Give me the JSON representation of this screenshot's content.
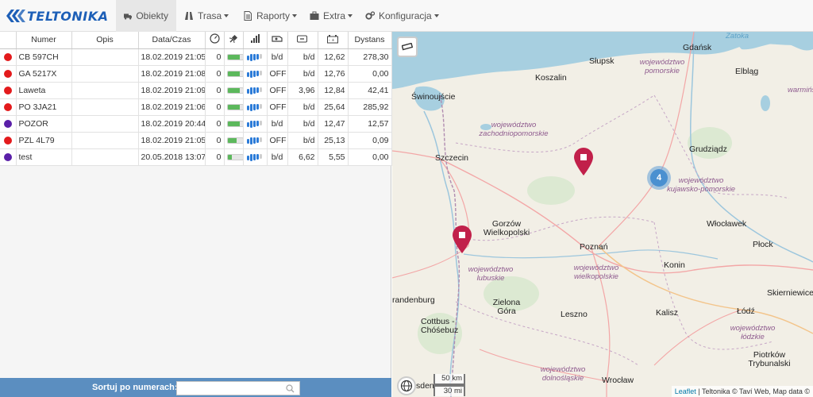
{
  "brand": {
    "name": "TELTONIKA",
    "color": "#1d5fb7"
  },
  "nav": {
    "items": [
      {
        "label": "Obiekty",
        "icon": "truck-icon",
        "active": true,
        "dropdown": false
      },
      {
        "label": "Trasa",
        "icon": "road-icon",
        "active": false,
        "dropdown": true
      },
      {
        "label": "Raporty",
        "icon": "document-icon",
        "active": false,
        "dropdown": true
      },
      {
        "label": "Extra",
        "icon": "briefcase-icon",
        "active": false,
        "dropdown": true
      },
      {
        "label": "Konfiguracja",
        "icon": "gears-icon",
        "active": false,
        "dropdown": true
      }
    ]
  },
  "table": {
    "columns": [
      "",
      "Numer",
      "Opis",
      "Data/Czas",
      "speedometer-icon",
      "satellite-icon",
      "signal-icon",
      "engine-icon",
      "battery-icon",
      "car-battery-icon",
      "Dystans"
    ],
    "rows": [
      {
        "status": "#e31a1c",
        "numer": "CB 597CH",
        "opis": "",
        "data": "18.02.2019 21:05",
        "speed": "0",
        "sat": 0.8,
        "gsm": 4,
        "engine": "b/d",
        "v1": "b/d",
        "v2": "12,62",
        "dystans": "278,30"
      },
      {
        "status": "#e31a1c",
        "numer": "GA 5217X",
        "opis": "",
        "data": "18.02.2019 21:08",
        "speed": "0",
        "sat": 0.8,
        "gsm": 4,
        "engine": "OFF",
        "v1": "b/d",
        "v2": "12,76",
        "dystans": "0,00"
      },
      {
        "status": "#e31a1c",
        "numer": "Laweta",
        "opis": "",
        "data": "18.02.2019 21:09",
        "speed": "0",
        "sat": 0.8,
        "gsm": 4,
        "engine": "OFF",
        "v1": "3,96",
        "v2": "12,84",
        "dystans": "42,41"
      },
      {
        "status": "#e31a1c",
        "numer": "PO 3JA21",
        "opis": "",
        "data": "18.02.2019 21:06",
        "speed": "0",
        "sat": 0.8,
        "gsm": 4,
        "engine": "OFF",
        "v1": "b/d",
        "v2": "25,64",
        "dystans": "285,92"
      },
      {
        "status": "#5a1fa8",
        "numer": "POZOR",
        "opis": "",
        "data": "18.02.2019 20:44",
        "speed": "0",
        "sat": 0.8,
        "gsm": 4,
        "engine": "b/d",
        "v1": "b/d",
        "v2": "12,47",
        "dystans": "12,57"
      },
      {
        "status": "#e31a1c",
        "numer": "PZL 4L79",
        "opis": "",
        "data": "18.02.2019 21:05",
        "speed": "0",
        "sat": 0.6,
        "gsm": 4,
        "engine": "OFF",
        "v1": "b/d",
        "v2": "25,13",
        "dystans": "0,09"
      },
      {
        "status": "#5a1fa8",
        "numer": "test",
        "opis": "",
        "data": "20.05.2018 13:07",
        "speed": "0",
        "sat": 0.3,
        "gsm": 4,
        "engine": "b/d",
        "v1": "6,62",
        "v2": "5,55",
        "dystans": "0,00"
      }
    ]
  },
  "sort": {
    "label": "Sortuj po numerach:",
    "value": ""
  },
  "map": {
    "labels": {
      "slupsk": "Słupsk",
      "gdansk": "Gdańsk",
      "zatoka": "Zatoka",
      "elblag": "Elbląg",
      "koszalin": "Koszalin",
      "swinoujscie": "Świnoujście",
      "szczecin": "Szczecin",
      "grudziadz": "Grudziądz",
      "gorzow": "Gorzów Wielkopolski",
      "poznan": "Poznań",
      "konin": "Konin",
      "wloclawek": "Włocławek",
      "plock": "Płock",
      "zielona": "Zielona Góra",
      "leszno": "Leszno",
      "kalisz": "Kalisz",
      "lodz": "Łódź",
      "skierniewice": "Skierniewice",
      "piotrkow": "Piotrków Trybunalski",
      "wroclaw": "Wrocław",
      "cottbus": "Cottbus - Chóśebuz",
      "brandenburg": "randenburg",
      "sden": "sden",
      "r_pomorskie": "województwo pomorskie",
      "r_zachodnio": "województwo zachodniopomorskie",
      "r_kujawsko": "województwo kujawsko-pomorskie",
      "r_lubuskie": "województwo lubuskie",
      "r_wielkopolskie": "województwo wielkopolskie",
      "r_lodzkie": "województwo łódzkie",
      "r_dolnoslaskie": "województwo dolnośląskie",
      "r_warminsko": "warmińsk"
    },
    "cluster_count": "4",
    "scale_km": "50 km",
    "scale_mi": "30 mi",
    "attribution_link": "Leaflet",
    "attribution_text": " | Teltonika © Taví Web, Map data ©"
  }
}
